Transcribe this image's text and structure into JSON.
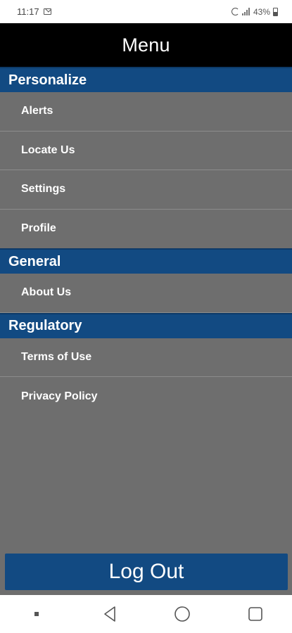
{
  "status_bar": {
    "time": "11:17",
    "battery": "43%",
    "icons": [
      "mail-icon",
      "sync-icon",
      "signal-icon",
      "battery-icon"
    ]
  },
  "title_bar": {
    "title": "Menu"
  },
  "sections": [
    {
      "header": "Personalize",
      "items": [
        "Alerts",
        "Locate Us",
        "Settings",
        "Profile"
      ]
    },
    {
      "header": "General",
      "items": [
        "About Us"
      ]
    },
    {
      "header": "Regulatory",
      "items": [
        "Terms of Use",
        "Privacy Policy"
      ]
    }
  ],
  "logout": {
    "label": "Log Out"
  },
  "nav_bar": {
    "icons": [
      "recent-dot-icon",
      "back-icon",
      "home-icon",
      "overview-icon"
    ]
  },
  "colors": {
    "header_blue": "#124a82",
    "menu_gray": "#6e6e6e",
    "title_black": "#000000"
  }
}
